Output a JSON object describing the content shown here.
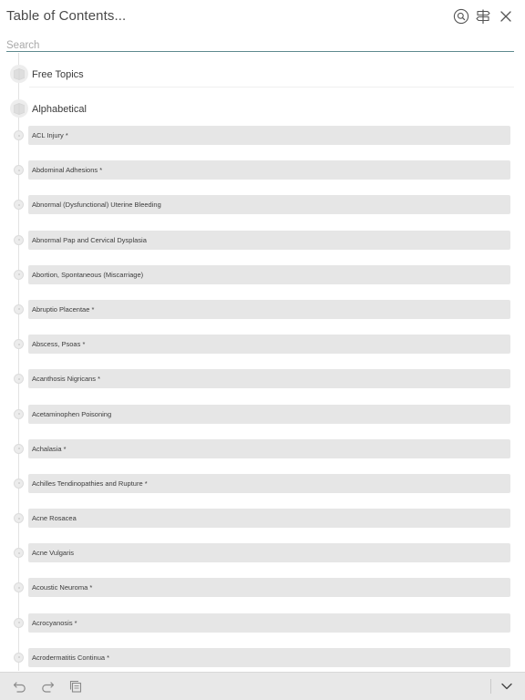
{
  "header": {
    "title": "Table of Contents...",
    "search_button_icon": "search-icon",
    "signpost_button_icon": "signpost-icon",
    "close_button_icon": "close-icon"
  },
  "search": {
    "placeholder": "Search",
    "value": ""
  },
  "sections": [
    {
      "label": "Free Topics",
      "icon": "book-icon"
    },
    {
      "label": "Alphabetical",
      "icon": "book-icon"
    }
  ],
  "items": [
    {
      "label": "ACL Injury *"
    },
    {
      "label": "Abdominal Adhesions *"
    },
    {
      "label": "Abnormal (Dysfunctional) Uterine Bleeding"
    },
    {
      "label": "Abnormal Pap and Cervical Dysplasia"
    },
    {
      "label": "Abortion, Spontaneous (Miscarriage)"
    },
    {
      "label": "Abruptio Placentae *"
    },
    {
      "label": "Abscess, Psoas *"
    },
    {
      "label": "Acanthosis Nigricans *"
    },
    {
      "label": "Acetaminophen Poisoning"
    },
    {
      "label": "Achalasia *"
    },
    {
      "label": "Achilles Tendinopathies and Rupture *"
    },
    {
      "label": "Acne Rosacea"
    },
    {
      "label": "Acne Vulgaris"
    },
    {
      "label": "Acoustic Neuroma *"
    },
    {
      "label": "Acrocyanosis *"
    },
    {
      "label": "Acrodermatitis Continua *"
    }
  ],
  "toolbar": {
    "back_icon": "undo-arrow-icon",
    "forward_icon": "redo-arrow-icon",
    "copy_icon": "copy-icon",
    "collapse_icon": "chevron-down-icon"
  },
  "colors": {
    "accent_underline": "#5f8a8f",
    "item_bar": "#e6e6e6",
    "toolbar_bg": "#e8e8e8"
  }
}
